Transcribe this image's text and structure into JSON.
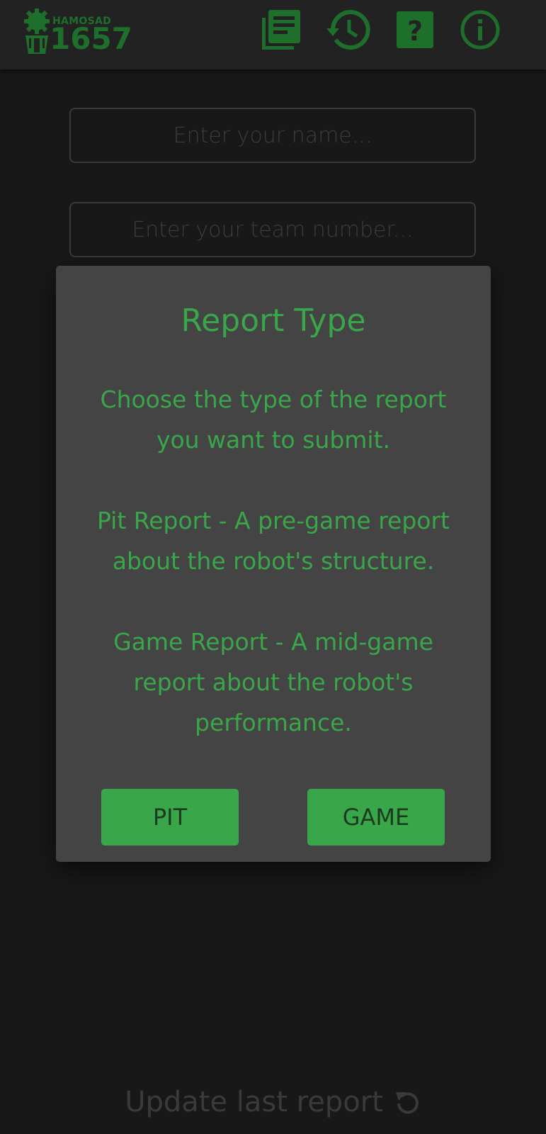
{
  "header": {
    "logo": {
      "small_text": "HAMOSAD",
      "big_text": "1657"
    },
    "icons": [
      {
        "name": "reports-list-icon"
      },
      {
        "name": "history-icon"
      },
      {
        "name": "help-icon"
      },
      {
        "name": "info-icon"
      }
    ]
  },
  "form": {
    "name_placeholder": "Enter your name...",
    "team_placeholder": "Enter your team number..."
  },
  "footer": {
    "update_label": "Update last report"
  },
  "dialog": {
    "title": "Report Type",
    "paragraphs": [
      "Choose the type of the report you want to submit.",
      "Pit Report - A pre-game report about the robot's structure.",
      "Game Report - A mid-game report about the robot's performance."
    ],
    "buttons": {
      "pit": "PIT",
      "game": "GAME"
    }
  },
  "colors": {
    "accent": "#3aa64a",
    "logo": "#1e6e2c",
    "background": "#181818",
    "dialog_bg": "#444444"
  }
}
